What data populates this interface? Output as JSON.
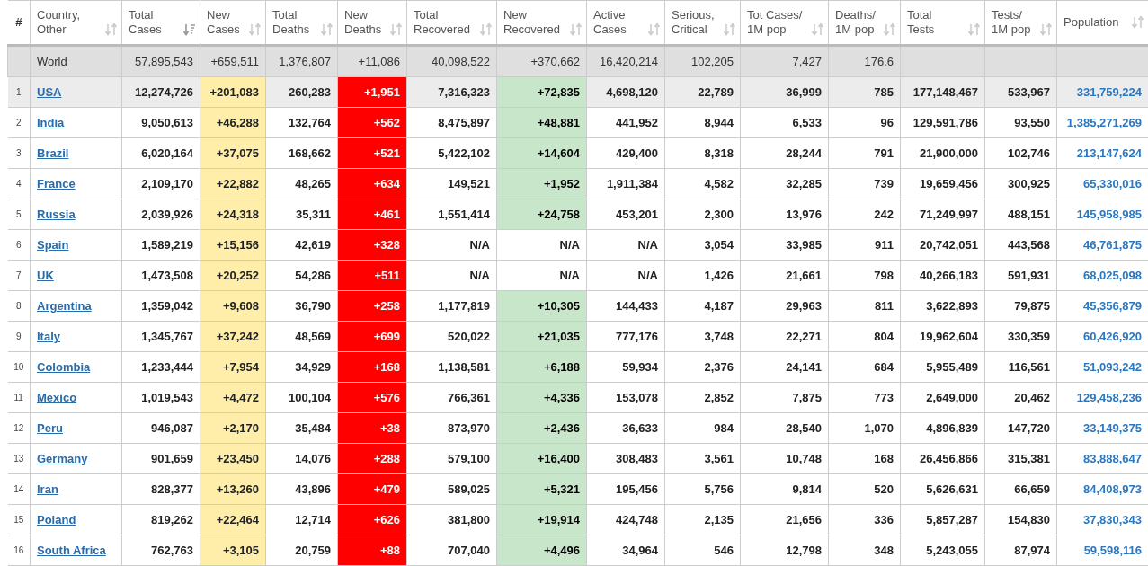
{
  "columns": [
    {
      "label": "#",
      "kind": "rank"
    },
    {
      "label": "Country,\nOther",
      "kind": "country",
      "sorted": false
    },
    {
      "label": "Total\nCases",
      "kind": "number",
      "sorted": true
    },
    {
      "label": "New\nCases",
      "kind": "new_cases",
      "sorted": false
    },
    {
      "label": "Total\nDeaths",
      "kind": "number",
      "sorted": false
    },
    {
      "label": "New\nDeaths",
      "kind": "new_deaths",
      "sorted": false
    },
    {
      "label": "Total\nRecovered",
      "kind": "number",
      "sorted": false
    },
    {
      "label": "New\nRecovered",
      "kind": "new_recovered",
      "sorted": false
    },
    {
      "label": "Active\nCases",
      "kind": "number",
      "sorted": false
    },
    {
      "label": "Serious,\nCritical",
      "kind": "number",
      "sorted": false
    },
    {
      "label": "Tot Cases/\n1M pop",
      "kind": "number",
      "sorted": false
    },
    {
      "label": "Deaths/\n1M pop",
      "kind": "number",
      "sorted": false
    },
    {
      "label": "Total\nTests",
      "kind": "number",
      "sorted": false
    },
    {
      "label": "Tests/\n1M pop",
      "kind": "number",
      "sorted": false
    },
    {
      "label": "Population",
      "kind": "population",
      "sorted": false
    }
  ],
  "world": {
    "name": "World",
    "values": [
      "57,895,543",
      "+659,511",
      "1,376,807",
      "+11,086",
      "40,098,522",
      "+370,662",
      "16,420,214",
      "102,205",
      "7,427",
      "176.6"
    ]
  },
  "rows": [
    {
      "rank": "1",
      "country": "USA",
      "selected": true,
      "recovered_highlight": true,
      "values": [
        "12,274,726",
        "+201,083",
        "260,283",
        "+1,951",
        "7,316,323",
        "+72,835",
        "4,698,120",
        "22,789",
        "36,999",
        "785",
        "177,148,467",
        "533,967",
        "331,759,224"
      ]
    },
    {
      "rank": "2",
      "country": "India",
      "selected": false,
      "recovered_highlight": true,
      "values": [
        "9,050,613",
        "+46,288",
        "132,764",
        "+562",
        "8,475,897",
        "+48,881",
        "441,952",
        "8,944",
        "6,533",
        "96",
        "129,591,786",
        "93,550",
        "1,385,271,269"
      ]
    },
    {
      "rank": "3",
      "country": "Brazil",
      "selected": false,
      "recovered_highlight": true,
      "values": [
        "6,020,164",
        "+37,075",
        "168,662",
        "+521",
        "5,422,102",
        "+14,604",
        "429,400",
        "8,318",
        "28,244",
        "791",
        "21,900,000",
        "102,746",
        "213,147,624"
      ]
    },
    {
      "rank": "4",
      "country": "France",
      "selected": false,
      "recovered_highlight": true,
      "values": [
        "2,109,170",
        "+22,882",
        "48,265",
        "+634",
        "149,521",
        "+1,952",
        "1,911,384",
        "4,582",
        "32,285",
        "739",
        "19,659,456",
        "300,925",
        "65,330,016"
      ]
    },
    {
      "rank": "5",
      "country": "Russia",
      "selected": false,
      "recovered_highlight": true,
      "values": [
        "2,039,926",
        "+24,318",
        "35,311",
        "+461",
        "1,551,414",
        "+24,758",
        "453,201",
        "2,300",
        "13,976",
        "242",
        "71,249,997",
        "488,151",
        "145,958,985"
      ]
    },
    {
      "rank": "6",
      "country": "Spain",
      "selected": false,
      "recovered_highlight": false,
      "values": [
        "1,589,219",
        "+15,156",
        "42,619",
        "+328",
        "N/A",
        "N/A",
        "N/A",
        "3,054",
        "33,985",
        "911",
        "20,742,051",
        "443,568",
        "46,761,875"
      ]
    },
    {
      "rank": "7",
      "country": "UK",
      "selected": false,
      "recovered_highlight": false,
      "values": [
        "1,473,508",
        "+20,252",
        "54,286",
        "+511",
        "N/A",
        "N/A",
        "N/A",
        "1,426",
        "21,661",
        "798",
        "40,266,183",
        "591,931",
        "68,025,098"
      ]
    },
    {
      "rank": "8",
      "country": "Argentina",
      "selected": false,
      "recovered_highlight": true,
      "values": [
        "1,359,042",
        "+9,608",
        "36,790",
        "+258",
        "1,177,819",
        "+10,305",
        "144,433",
        "4,187",
        "29,963",
        "811",
        "3,622,893",
        "79,875",
        "45,356,879"
      ]
    },
    {
      "rank": "9",
      "country": "Italy",
      "selected": false,
      "recovered_highlight": true,
      "values": [
        "1,345,767",
        "+37,242",
        "48,569",
        "+699",
        "520,022",
        "+21,035",
        "777,176",
        "3,748",
        "22,271",
        "804",
        "19,962,604",
        "330,359",
        "60,426,920"
      ]
    },
    {
      "rank": "10",
      "country": "Colombia",
      "selected": false,
      "recovered_highlight": true,
      "values": [
        "1,233,444",
        "+7,954",
        "34,929",
        "+168",
        "1,138,581",
        "+6,188",
        "59,934",
        "2,376",
        "24,141",
        "684",
        "5,955,489",
        "116,561",
        "51,093,242"
      ]
    },
    {
      "rank": "11",
      "country": "Mexico",
      "selected": false,
      "recovered_highlight": true,
      "values": [
        "1,019,543",
        "+4,472",
        "100,104",
        "+576",
        "766,361",
        "+4,336",
        "153,078",
        "2,852",
        "7,875",
        "773",
        "2,649,000",
        "20,462",
        "129,458,236"
      ]
    },
    {
      "rank": "12",
      "country": "Peru",
      "selected": false,
      "recovered_highlight": true,
      "values": [
        "946,087",
        "+2,170",
        "35,484",
        "+38",
        "873,970",
        "+2,436",
        "36,633",
        "984",
        "28,540",
        "1,070",
        "4,896,839",
        "147,720",
        "33,149,375"
      ]
    },
    {
      "rank": "13",
      "country": "Germany",
      "selected": false,
      "recovered_highlight": true,
      "values": [
        "901,659",
        "+23,450",
        "14,076",
        "+288",
        "579,100",
        "+16,400",
        "308,483",
        "3,561",
        "10,748",
        "168",
        "26,456,866",
        "315,381",
        "83,888,647"
      ]
    },
    {
      "rank": "14",
      "country": "Iran",
      "selected": false,
      "recovered_highlight": true,
      "values": [
        "828,377",
        "+13,260",
        "43,896",
        "+479",
        "589,025",
        "+5,321",
        "195,456",
        "5,756",
        "9,814",
        "520",
        "5,626,631",
        "66,659",
        "84,408,973"
      ]
    },
    {
      "rank": "15",
      "country": "Poland",
      "selected": false,
      "recovered_highlight": true,
      "values": [
        "819,262",
        "+22,464",
        "12,714",
        "+626",
        "381,800",
        "+19,914",
        "424,748",
        "2,135",
        "21,656",
        "336",
        "5,857,287",
        "154,830",
        "37,830,343"
      ]
    },
    {
      "rank": "16",
      "country": "South Africa",
      "selected": false,
      "recovered_highlight": true,
      "values": [
        "762,763",
        "+3,105",
        "20,759",
        "+88",
        "707,040",
        "+4,496",
        "34,964",
        "546",
        "12,798",
        "348",
        "5,243,055",
        "87,974",
        "59,598,116"
      ]
    }
  ]
}
